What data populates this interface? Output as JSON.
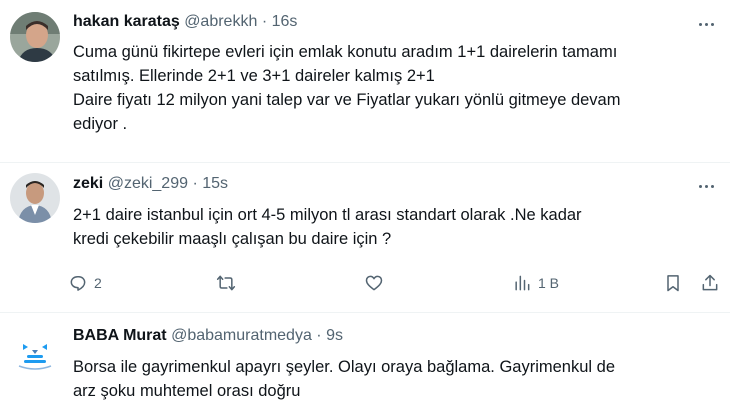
{
  "tweets": [
    {
      "name": "hakan karataş",
      "handle": "@abrekkh",
      "sep": "·",
      "time": "16s",
      "lines": [
        "Cuma günü fikirtepe evleri için emlak konutu aradım 1+1 dairelerin tamamı",
        "satılmış. Ellerinde 2+1 ve 3+1 daireler kalmış 2+1",
        "Daire fiyatı 12 milyon yani talep var ve Fiyatlar yukarı yönlü gitmeye devam",
        "ediyor ."
      ]
    },
    {
      "name": "zeki",
      "handle": "@zeki_299",
      "sep": "·",
      "time": "15s",
      "lines": [
        "2+1 daire istanbul için ort 4-5  milyon tl  arası standart olarak .Ne kadar",
        "kredi çekebilir maaşlı çalışan bu daire için ?"
      ],
      "actions": {
        "reply_count": "2",
        "views_count": "1 B"
      }
    },
    {
      "name": "BABA Murat",
      "handle": "@babamuratmedya",
      "sep": "·",
      "time": "9s",
      "lines": [
        "Borsa ile gayrimenkul apayrı şeyler. Olayı oraya bağlama. Gayrimenkul de",
        "arz şoku muhtemel orası doğru"
      ]
    }
  ],
  "icons": {
    "more": "more-dots-icon",
    "reply": "reply-icon",
    "retweet": "retweet-icon",
    "like": "heart-icon",
    "views": "analytics-icon",
    "bookmark": "bookmark-icon",
    "share": "share-icon"
  },
  "colors": {
    "text": "#0f1419",
    "secondary": "#536471",
    "divider": "#eff3f4",
    "brand_logo": "#1d9bf0"
  }
}
